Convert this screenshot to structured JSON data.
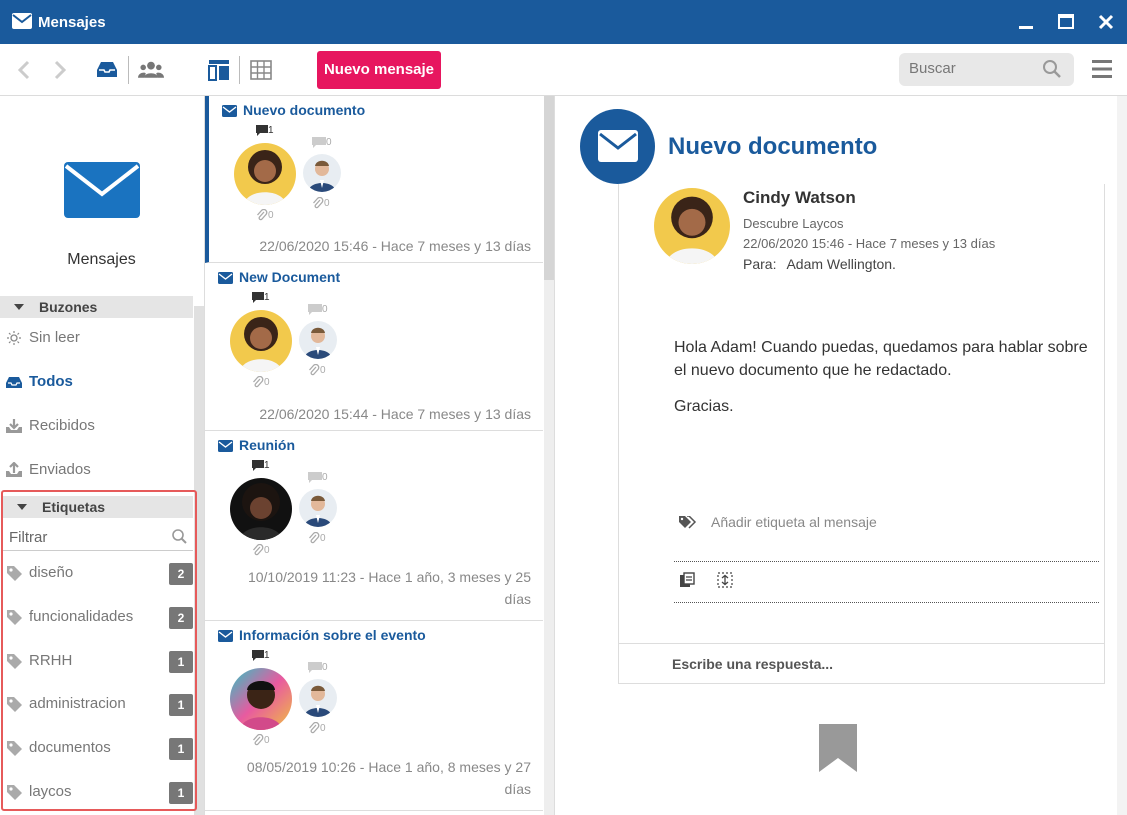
{
  "window": {
    "title": "Mensajes"
  },
  "toolbar": {
    "new_message_label": "Nuevo mensaje",
    "search_placeholder": "Buscar"
  },
  "sidebar": {
    "brand_label": "Mensajes",
    "mailboxes_header": "Buzones",
    "nav": [
      {
        "label": "Sin leer",
        "icon": "sun-icon"
      },
      {
        "label": "Todos",
        "icon": "inbox-icon",
        "active": true
      },
      {
        "label": "Recibidos",
        "icon": "download-icon"
      },
      {
        "label": "Enviados",
        "icon": "upload-icon"
      }
    ],
    "labels_header": "Etiquetas",
    "filter_placeholder": "Filtrar",
    "tags": [
      {
        "label": "diseño",
        "count": "2"
      },
      {
        "label": "funcionalidades",
        "count": "2"
      },
      {
        "label": "RRHH",
        "count": "1"
      },
      {
        "label": "administracion",
        "count": "1"
      },
      {
        "label": "documentos",
        "count": "1"
      },
      {
        "label": "laycos",
        "count": "1"
      }
    ]
  },
  "messages": [
    {
      "subject": "Nuevo documento",
      "comments": "1",
      "comments_other": "0",
      "attach": "0",
      "attach_other": "0",
      "date": "22/06/2020 15:46 - Hace 7 meses y 13 días",
      "selected": true
    },
    {
      "subject": "New Document",
      "comments": "1",
      "comments_other": "0",
      "attach": "0",
      "attach_other": "0",
      "date": "22/06/2020 15:44 - Hace 7 meses y 13 días"
    },
    {
      "subject": "Reunión",
      "comments": "1",
      "comments_other": "0",
      "attach": "0",
      "attach_other": "0",
      "date": "10/10/2019 11:23 - Hace 1 año, 3 meses y 25 días"
    },
    {
      "subject": "Información sobre el evento",
      "comments": "1",
      "comments_other": "0",
      "attach": "0",
      "attach_other": "0",
      "date": "08/05/2019 10:26 - Hace 1 año, 8 meses y 27 días"
    }
  ],
  "reading": {
    "title": "Nuevo documento",
    "sender": "Cindy Watson",
    "sender_sub": "Descubre Laycos",
    "date": "22/06/2020 15:46 - Hace 7 meses y 13 días",
    "to_label": "Para:",
    "to": "Adam Wellington.",
    "body": [
      "Hola Adam! Cuando puedas, quedamos para hablar sobre el nuevo documento que he redactado.",
      "Gracias."
    ],
    "add_tag": "Añadir etiqueta al mensaje",
    "reply_placeholder": "Escribe una respuesta..."
  },
  "colors": {
    "brand": "#1a5a9c",
    "accent": "#e7165f",
    "highlight_border": "#e65a5a"
  }
}
